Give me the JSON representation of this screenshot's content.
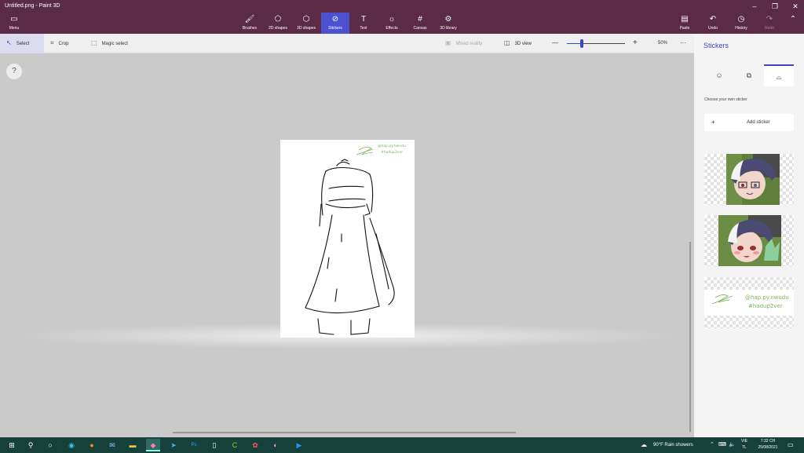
{
  "window": {
    "title": "Untitled.png - Paint 3D",
    "minimize": "–",
    "restore": "❐",
    "close": "✕"
  },
  "toolbar": {
    "menu": "Menu",
    "items": [
      {
        "label": "Brushes",
        "icon": "brush-icon",
        "glyph": "🖌"
      },
      {
        "label": "2D shapes",
        "icon": "shapes-2d-icon",
        "glyph": "⬠"
      },
      {
        "label": "3D shapes",
        "icon": "cube-icon",
        "glyph": "⬡"
      },
      {
        "label": "Stickers",
        "icon": "sticker-icon",
        "glyph": "⊘"
      },
      {
        "label": "Text",
        "icon": "text-icon",
        "glyph": "T"
      },
      {
        "label": "Effects",
        "icon": "effects-icon",
        "glyph": "☼"
      },
      {
        "label": "Canvas",
        "icon": "canvas-icon",
        "glyph": "#"
      },
      {
        "label": "3D library",
        "icon": "library-icon",
        "glyph": "⚙"
      }
    ],
    "paste": "Paste",
    "undo": "Undo",
    "history": "History",
    "redo": "Redo",
    "expand_glyph": "⌃"
  },
  "subtoolbar": {
    "select": "Select",
    "crop": "Crop",
    "magic_select": "Magic select",
    "mixed_reality": "Mixed reality",
    "view_3d": "3D view",
    "zoom_out": "—",
    "zoom_in": "+",
    "zoom_percent": "50%",
    "zoom_level": 0.25,
    "more": "···"
  },
  "help": "?",
  "panel": {
    "title": "Stickers",
    "choose_label": "Choose your own sticker",
    "add_sticker": "Add sticker",
    "add_glyph": "+",
    "tabs": [
      {
        "icon": "stickers-tab-icon",
        "glyph": "☺"
      },
      {
        "icon": "textures-tab-icon",
        "glyph": "⧉"
      },
      {
        "icon": "custom-sticker-tab-icon",
        "glyph": "⌓"
      }
    ]
  },
  "drawing": {
    "signature_line1": "@hap.py.nwudu",
    "signature_line2": "#hadup2ver"
  },
  "taskbar": {
    "weather": "90°F  Rain showers",
    "lang_line1": "VIE",
    "lang_line2": "TL",
    "time": "7:32 CH",
    "date": "25/08/2021",
    "ps_label": "Ps"
  }
}
